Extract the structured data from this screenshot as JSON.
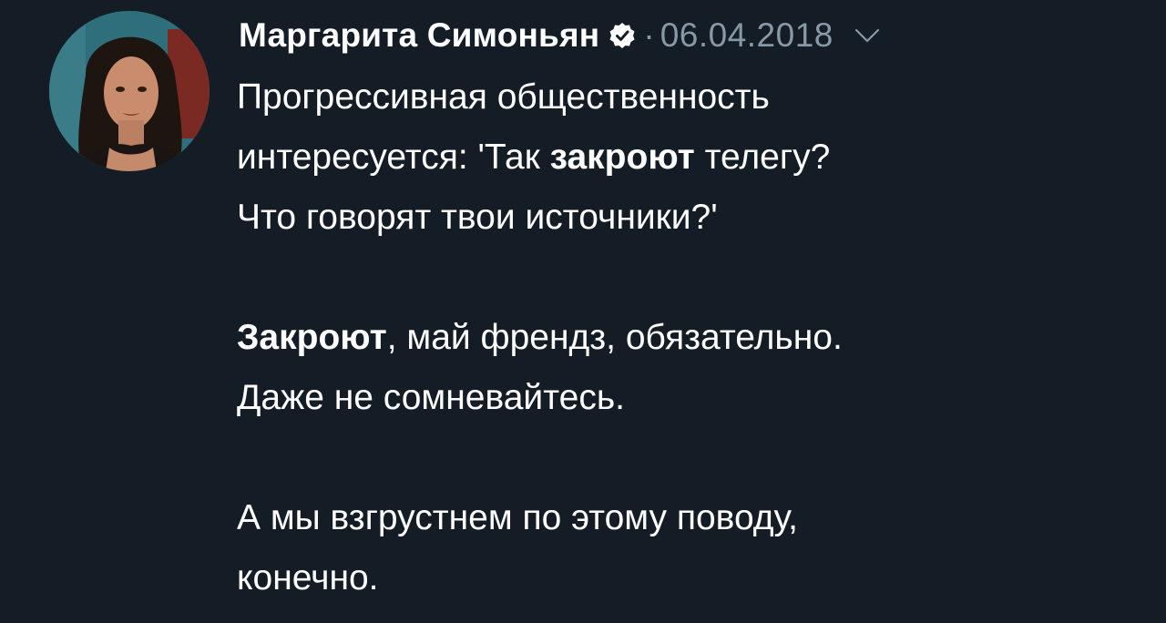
{
  "tweet": {
    "author": {
      "name": "Маргарита Симоньян",
      "verified": true,
      "avatar_icon": "avatar-photo"
    },
    "separator": "·",
    "date": "06.04.2018",
    "menu_icon": "chevron-down-icon",
    "paragraphs": [
      {
        "lines": [
          [
            {
              "text": "Прогрессивная общественность",
              "bold": false
            }
          ],
          [
            {
              "text": "интересуется: 'Так ",
              "bold": false
            },
            {
              "text": "закроют",
              "bold": true
            },
            {
              "text": " телегу?",
              "bold": false
            }
          ],
          [
            {
              "text": "Что говорят твои источники?'",
              "bold": false
            }
          ]
        ]
      },
      {
        "lines": [
          [
            {
              "text": "Закроют",
              "bold": true
            },
            {
              "text": ", май френдз, обязательно.",
              "bold": false
            }
          ],
          [
            {
              "text": "Даже не сомневайтесь.",
              "bold": false
            }
          ]
        ]
      },
      {
        "lines": [
          [
            {
              "text": "А мы взгрустнем по этому поводу,",
              "bold": false
            }
          ],
          [
            {
              "text": "конечно.",
              "bold": false
            }
          ]
        ]
      }
    ]
  },
  "colors": {
    "background": "#141d26",
    "text": "#ffffff",
    "muted": "#8899a6",
    "verified_badge": "#ffffff"
  }
}
